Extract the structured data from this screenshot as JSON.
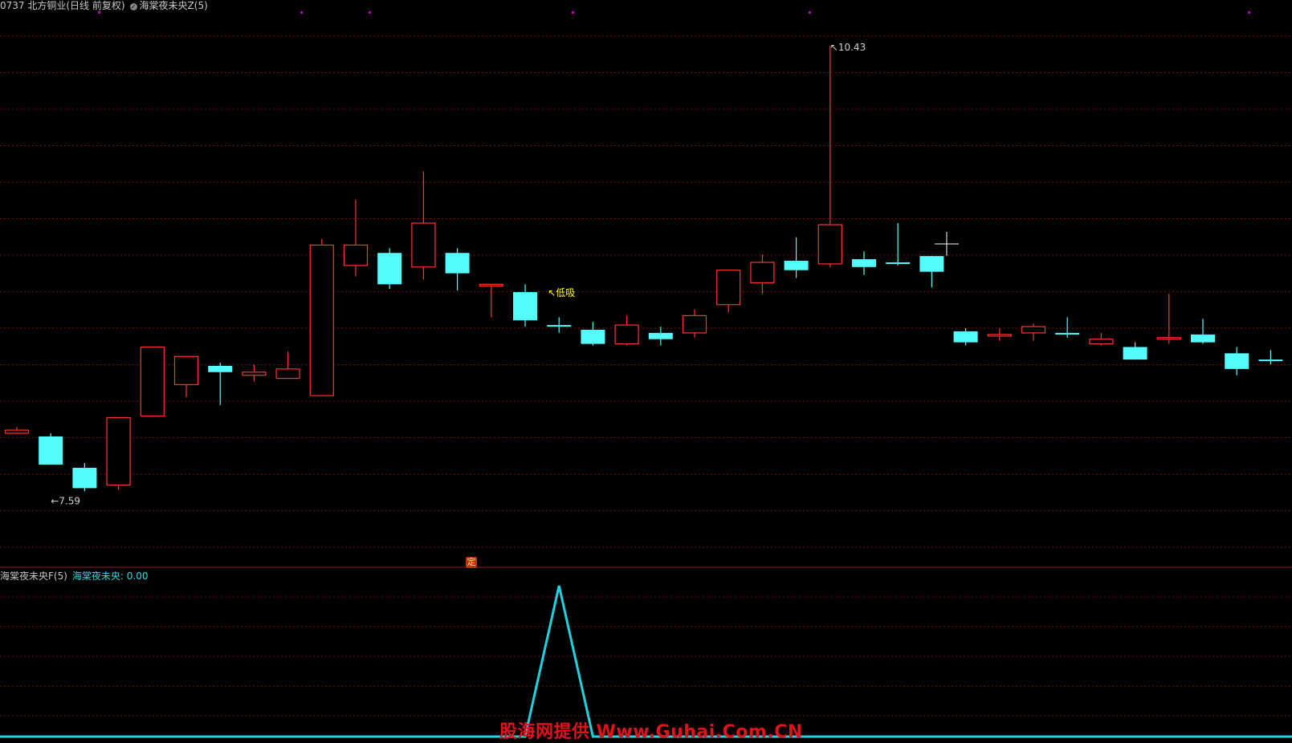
{
  "header": {
    "stock": "0737 北方铜业(日线 前复权)",
    "indicator_main": "海棠夜未央Z(5)"
  },
  "sub_header": {
    "indicator": "海棠夜未央F(5)",
    "value_label": "海棠夜未央: 0.00"
  },
  "badge": "定",
  "watermark": "股海网提供 Www.Guhai.Com.CN",
  "colors": {
    "up": "#ff3232",
    "down": "#54fcfc",
    "grid": "#7a1010",
    "signal_line": "#1ed2e0",
    "label": "#ffff00",
    "marker": "#c000c0"
  },
  "chart_data": {
    "type": "candlestick",
    "price_range": [
      7.3,
      10.6
    ],
    "annotations": [
      {
        "text": "10.43",
        "candle": 24,
        "price": 10.43,
        "kind": "high"
      },
      {
        "text": "7.59",
        "candle": 1,
        "price": 7.59,
        "kind": "low"
      },
      {
        "text": "低吸",
        "candle": 16,
        "price": 8.5,
        "kind": "signal"
      }
    ],
    "candles": [
      {
        "o": 7.98,
        "h": 8.0,
        "l": 7.96,
        "c": 7.96,
        "dir": "up"
      },
      {
        "o": 7.94,
        "h": 7.96,
        "l": 7.76,
        "c": 7.76,
        "dir": "down"
      },
      {
        "o": 7.74,
        "h": 7.77,
        "l": 7.59,
        "c": 7.61,
        "dir": "down"
      },
      {
        "o": 7.63,
        "h": 8.06,
        "l": 7.6,
        "c": 8.06,
        "dir": "up"
      },
      {
        "o": 8.07,
        "h": 8.5,
        "l": 8.07,
        "c": 8.51,
        "dir": "up"
      },
      {
        "o": 8.27,
        "h": 8.44,
        "l": 8.19,
        "c": 8.45,
        "dir": "up"
      },
      {
        "o": 8.39,
        "h": 8.41,
        "l": 8.14,
        "c": 8.35,
        "dir": "down"
      },
      {
        "o": 8.33,
        "h": 8.4,
        "l": 8.29,
        "c": 8.35,
        "dir": "up"
      },
      {
        "o": 8.31,
        "h": 8.48,
        "l": 8.31,
        "c": 8.37,
        "dir": "up"
      },
      {
        "o": 8.2,
        "h": 9.2,
        "l": 8.2,
        "c": 9.16,
        "dir": "up"
      },
      {
        "o": 9.03,
        "h": 9.45,
        "l": 8.96,
        "c": 9.16,
        "dir": "up"
      },
      {
        "o": 9.11,
        "h": 9.14,
        "l": 8.88,
        "c": 8.91,
        "dir": "down"
      },
      {
        "o": 9.02,
        "h": 9.63,
        "l": 8.94,
        "c": 9.3,
        "dir": "up"
      },
      {
        "o": 9.11,
        "h": 9.14,
        "l": 8.87,
        "c": 8.98,
        "dir": "down"
      },
      {
        "o": 8.91,
        "h": 8.91,
        "l": 8.7,
        "c": 8.91,
        "dir": "up"
      },
      {
        "o": 8.86,
        "h": 8.91,
        "l": 8.64,
        "c": 8.68,
        "dir": "down"
      },
      {
        "o": 8.65,
        "h": 8.7,
        "l": 8.6,
        "c": 8.64,
        "dir": "down"
      },
      {
        "o": 8.62,
        "h": 8.67,
        "l": 8.52,
        "c": 8.53,
        "dir": "down"
      },
      {
        "o": 8.53,
        "h": 8.71,
        "l": 8.52,
        "c": 8.65,
        "dir": "up"
      },
      {
        "o": 8.6,
        "h": 8.64,
        "l": 8.52,
        "c": 8.56,
        "dir": "down"
      },
      {
        "o": 8.6,
        "h": 8.75,
        "l": 8.57,
        "c": 8.71,
        "dir": "up"
      },
      {
        "o": 8.78,
        "h": 9.0,
        "l": 8.73,
        "c": 9.0,
        "dir": "up"
      },
      {
        "o": 8.92,
        "h": 9.1,
        "l": 8.85,
        "c": 9.05,
        "dir": "up"
      },
      {
        "o": 9.06,
        "h": 9.21,
        "l": 8.95,
        "c": 9.0,
        "dir": "down"
      },
      {
        "o": 9.04,
        "h": 10.43,
        "l": 9.02,
        "c": 9.29,
        "dir": "up"
      },
      {
        "o": 9.07,
        "h": 9.12,
        "l": 8.97,
        "c": 9.02,
        "dir": "down"
      },
      {
        "o": 9.05,
        "h": 9.3,
        "l": 9.03,
        "c": 9.05,
        "dir": "down"
      },
      {
        "o": 9.09,
        "h": 9.09,
        "l": 8.89,
        "c": 8.99,
        "dir": "down"
      },
      {
        "o": 8.61,
        "h": 8.63,
        "l": 8.52,
        "c": 8.54,
        "dir": "down"
      },
      {
        "o": 8.58,
        "h": 8.63,
        "l": 8.55,
        "c": 8.59,
        "dir": "up"
      },
      {
        "o": 8.6,
        "h": 8.66,
        "l": 8.55,
        "c": 8.64,
        "dir": "up"
      },
      {
        "o": 8.6,
        "h": 8.7,
        "l": 8.57,
        "c": 8.6,
        "dir": "down"
      },
      {
        "o": 8.53,
        "h": 8.6,
        "l": 8.52,
        "c": 8.56,
        "dir": "up"
      },
      {
        "o": 8.51,
        "h": 8.54,
        "l": 8.43,
        "c": 8.43,
        "dir": "down"
      },
      {
        "o": 8.57,
        "h": 8.85,
        "l": 8.53,
        "c": 8.57,
        "dir": "up"
      },
      {
        "o": 8.59,
        "h": 8.69,
        "l": 8.53,
        "c": 8.54,
        "dir": "down"
      },
      {
        "o": 8.47,
        "h": 8.51,
        "l": 8.33,
        "c": 8.37,
        "dir": "down"
      },
      {
        "o": 8.43,
        "h": 8.49,
        "l": 8.4,
        "c": 8.43,
        "dir": "down"
      }
    ],
    "indicator": {
      "name": "海棠夜未央",
      "values": [
        0,
        0,
        0,
        0,
        0,
        0,
        0,
        0,
        0,
        0,
        0,
        0,
        0,
        0,
        0,
        0,
        1,
        0,
        0,
        0,
        0,
        0,
        0,
        0,
        0,
        0,
        0,
        0,
        0,
        0,
        0,
        0,
        0,
        0,
        0,
        0,
        0,
        0
      ],
      "ylim": [
        0,
        1
      ]
    }
  }
}
